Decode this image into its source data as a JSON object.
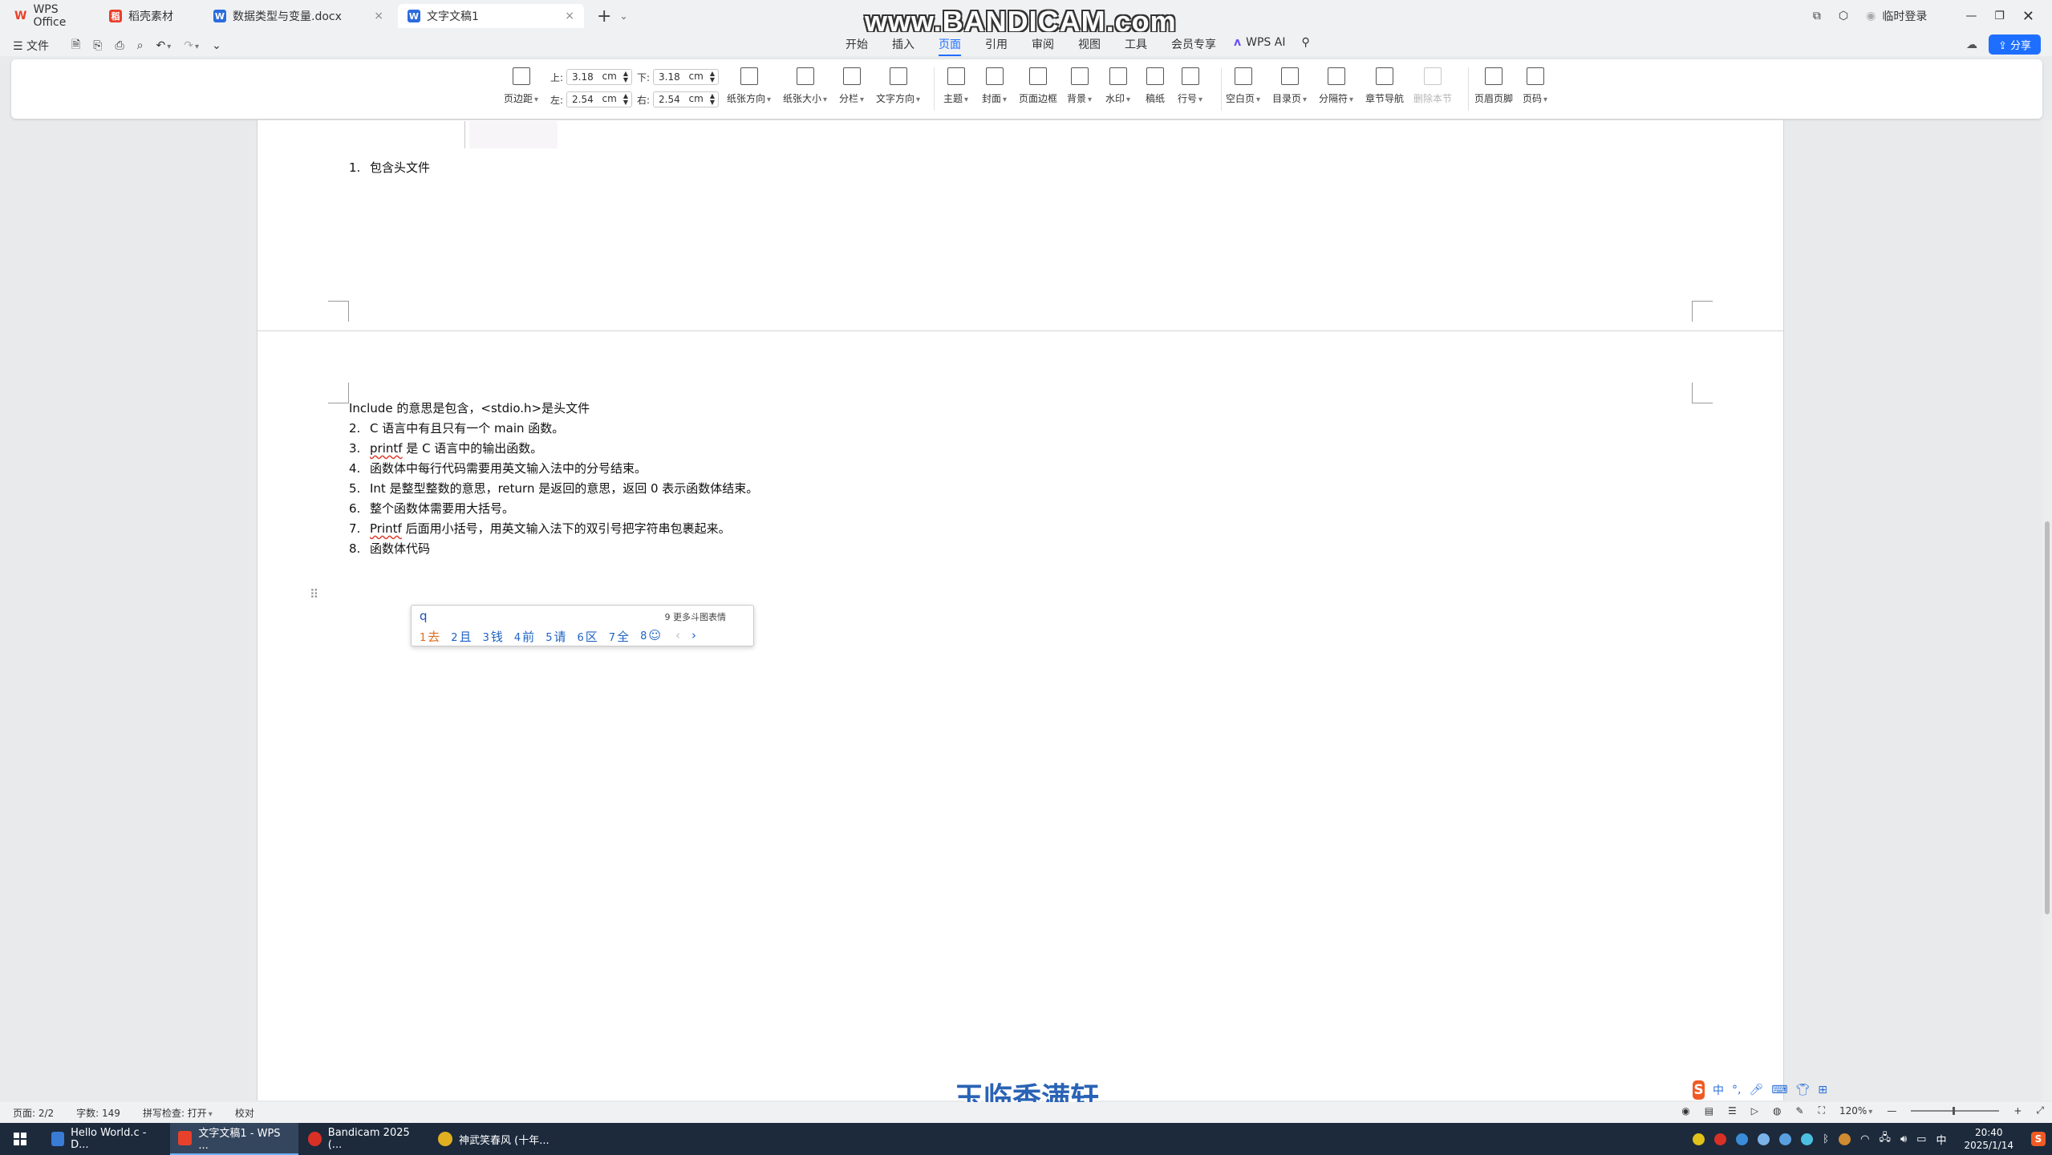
{
  "tabs": [
    {
      "label": "WPS Office",
      "icon": "wps-logo-icon",
      "color": "#e8412b"
    },
    {
      "label": "稻壳素材",
      "icon": "docer-icon",
      "color": "#e8412b"
    },
    {
      "label": "数据类型与变量.docx",
      "icon": "word-doc-icon",
      "color": "#2b6cde"
    },
    {
      "label": "文字文稿1",
      "icon": "word-doc-icon",
      "color": "#2b6cde"
    }
  ],
  "titlebar": {
    "login": "临时登录"
  },
  "watermark_top": "www.BANDICAM.com",
  "menu": {
    "file": "文件",
    "tabs": [
      "开始",
      "插入",
      "页面",
      "引用",
      "审阅",
      "视图",
      "工具",
      "会员专享"
    ],
    "active_tab": "页面",
    "wps_ai": "WPS AI",
    "share": "分享"
  },
  "ribbon": {
    "margins_label": "页边距",
    "margin_top_label": "上:",
    "margin_top": "3.18",
    "margin_bottom_label": "下:",
    "margin_bottom": "3.18",
    "margin_left_label": "左:",
    "margin_left": "2.54",
    "margin_right_label": "右:",
    "margin_right": "2.54",
    "unit": "cm",
    "orientation": "纸张方向",
    "size": "纸张大小",
    "columns": "分栏",
    "text_direction": "文字方向",
    "theme": "主题",
    "cover": "封面",
    "page_border": "页面边框",
    "background": "背景",
    "watermark": "水印",
    "manuscript": "稿纸",
    "line_numbers": "行号",
    "blank_page": "空白页",
    "toc_page": "目录页",
    "breaks": "分隔符",
    "section_nav": "章节导航",
    "delete_section": "删除本节",
    "header_footer": "页眉页脚",
    "page_number": "页码"
  },
  "document": {
    "page1_item": {
      "num": "1.",
      "text": "包含头文件"
    },
    "page2_intro": "Include 的意思是包含，<stdio.h>是头文件",
    "items": [
      {
        "num": "2.",
        "text": "C 语言中有且只有一个 main 函数。"
      },
      {
        "num": "3.",
        "text_spell": "printf",
        "text": " 是 C 语言中的输出函数。"
      },
      {
        "num": "4.",
        "text": "函数体中每行代码需要用英文输入法中的分号结束。"
      },
      {
        "num": "5.",
        "text": "Int 是整型整数的意思，return 是返回的意思，返回 0 表示函数体结束。"
      },
      {
        "num": "6.",
        "text": "整个函数体需要用大括号。"
      },
      {
        "num": "7.",
        "text_spell": "Printf",
        "text": " 后面用小括号，用英文输入法下的双引号把字符串包裹起来。"
      },
      {
        "num": "8.",
        "text": "函数体代码"
      }
    ]
  },
  "ime": {
    "composition": "q",
    "more": "9 更多斗图表情",
    "candidates": [
      {
        "n": "1",
        "c": "去"
      },
      {
        "n": "2",
        "c": "且"
      },
      {
        "n": "3",
        "c": "钱"
      },
      {
        "n": "4",
        "c": "前"
      },
      {
        "n": "5",
        "c": "请"
      },
      {
        "n": "6",
        "c": "区"
      },
      {
        "n": "7",
        "c": "全"
      },
      {
        "n": "8",
        "c": ""
      }
    ]
  },
  "watermark_bottom": "玉临香满轩",
  "sogou": {
    "mode": "中"
  },
  "status": {
    "page": "页面: 2/2",
    "words": "字数: 149",
    "spellcheck": "拼写检查: 打开",
    "proof": "校对",
    "zoom": "120%"
  },
  "taskbar": {
    "items": [
      {
        "label": "Hello World.c - D...",
        "color": "#3a7bd5"
      },
      {
        "label": "文字文稿1 - WPS ...",
        "color": "#e8412b"
      },
      {
        "label": "Bandicam 2025 (...",
        "color": "#d93025"
      },
      {
        "label": "神武笑春风 (十年...",
        "color": "#e0b020"
      }
    ],
    "time": "20:40",
    "date": "2025/1/14"
  }
}
